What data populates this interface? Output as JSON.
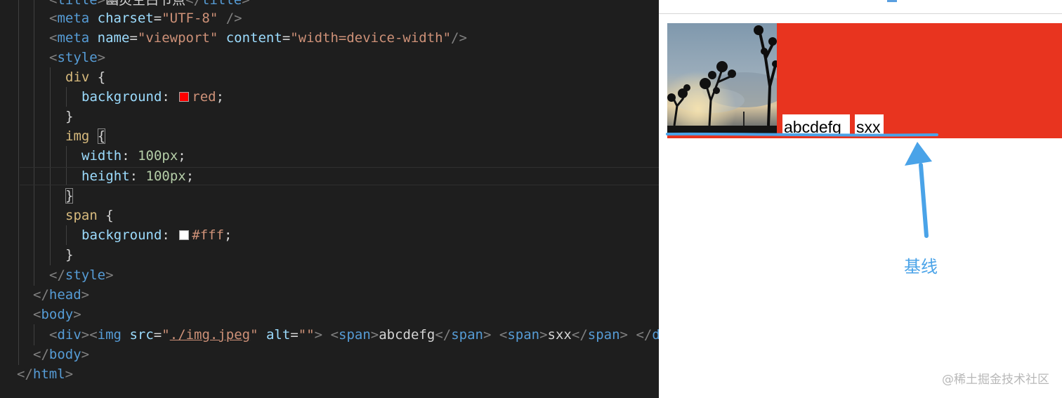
{
  "editor": {
    "lines": {
      "l0": {
        "text_a": "title",
        "text_b": "幽灵空白节点",
        "text_c": "title"
      },
      "l1": {
        "attr1": "charset",
        "val1": "\"UTF-8\""
      },
      "l2": {
        "attr1": "name",
        "val1": "\"viewport\"",
        "attr2": "content",
        "val2": "\"width=device-width\""
      },
      "l3": {
        "tag": "style"
      },
      "l4": {
        "selector": "div"
      },
      "l5": {
        "prop": "background",
        "value": "red",
        "swatch": "#ff0000"
      },
      "l7": {
        "selector": "img"
      },
      "l8": {
        "prop": "width",
        "value": "100px"
      },
      "l9": {
        "prop": "height",
        "value": "100px"
      },
      "l11": {
        "selector": "span"
      },
      "l12": {
        "prop": "background",
        "value": "#fff",
        "swatch": "#ffffff"
      },
      "l14": {
        "tag": "style"
      },
      "l15": {
        "tag": "head"
      },
      "l16": {
        "tag": "body"
      },
      "l17": {
        "src_attr": "src",
        "src_val": "./img.jpeg",
        "alt_attr": "alt",
        "alt_val": "\"\"",
        "span1": "abcdefg",
        "span2": "sxx",
        "tail": "di"
      },
      "l18": {
        "tag": "body"
      },
      "l19": {
        "tag": "html"
      }
    }
  },
  "preview": {
    "span1_text": "abcdefg",
    "span2_text": "sxx",
    "annotation_label": "基线",
    "watermark": "@稀土掘金技术社区",
    "colors": {
      "div_bg": "#e8341f",
      "annotation": "#4aa3e8"
    }
  }
}
